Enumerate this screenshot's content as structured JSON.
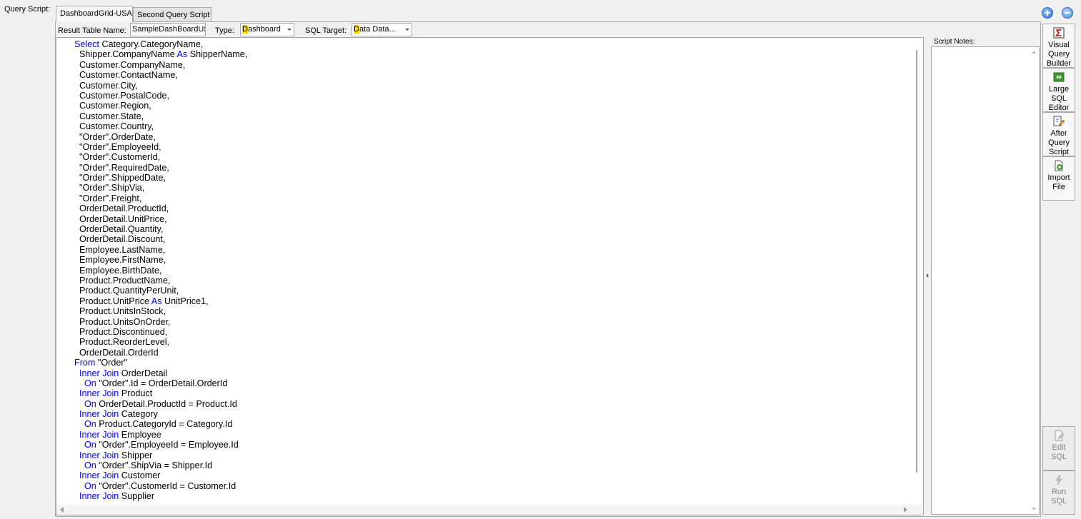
{
  "query_script_label": "Query Script:",
  "tabs": [
    {
      "label": "DashboardGrid-USA",
      "active": true
    },
    {
      "label": "Second Query Script",
      "active": false
    }
  ],
  "fields": {
    "result_table_label": "Result Table Name:",
    "result_table_value": "SampleDashBoardUS",
    "type_label": "Type:",
    "type_value_first": "D",
    "type_value_rest": "ashboard",
    "sql_target_label": "SQL Target:",
    "sql_target_value_first": "D",
    "sql_target_value_rest": "ata Data..."
  },
  "notes": {
    "label": "Script Notes:",
    "value": ""
  },
  "toolbar": {
    "visual_query_builder": "Visual\nQuery\nBuilder",
    "large_sql_editor": "Large\nSQL\nEditor",
    "after_query_script": "After\nQuery\nScript",
    "import_file": "Import\nFile",
    "edit_sql": "Edit\nSQL",
    "run_sql": "Run\nSQL"
  },
  "colors": {
    "keyword": "#0000ff",
    "highlight": "#ffd800"
  },
  "icons": [
    "add-circle-icon",
    "remove-circle-icon",
    "sigma-icon",
    "editor-icon",
    "script-pencil-icon",
    "import-file-icon",
    "edit-sql-icon",
    "lightning-icon"
  ],
  "code_lines": [
    {
      "indent": "",
      "kw": "Select",
      "text": " Category.CategoryName,"
    },
    {
      "indent": "  ",
      "kw": "",
      "text": "Shipper.CompanyName ",
      "kw2": "As",
      "text2": " ShipperName,"
    },
    {
      "indent": "  ",
      "kw": "",
      "text": "Customer.CompanyName,"
    },
    {
      "indent": "  ",
      "kw": "",
      "text": "Customer.ContactName,"
    },
    {
      "indent": "  ",
      "kw": "",
      "text": "Customer.City,"
    },
    {
      "indent": "  ",
      "kw": "",
      "text": "Customer.PostalCode,"
    },
    {
      "indent": "  ",
      "kw": "",
      "text": "Customer.Region,"
    },
    {
      "indent": "  ",
      "kw": "",
      "text": "Customer.State,"
    },
    {
      "indent": "  ",
      "kw": "",
      "text": "Customer.Country,"
    },
    {
      "indent": "  ",
      "kw": "",
      "text": "\"Order\".OrderDate,"
    },
    {
      "indent": "  ",
      "kw": "",
      "text": "\"Order\".EmployeeId,"
    },
    {
      "indent": "  ",
      "kw": "",
      "text": "\"Order\".CustomerId,"
    },
    {
      "indent": "  ",
      "kw": "",
      "text": "\"Order\".RequiredDate,"
    },
    {
      "indent": "  ",
      "kw": "",
      "text": "\"Order\".ShippedDate,"
    },
    {
      "indent": "  ",
      "kw": "",
      "text": "\"Order\".ShipVia,"
    },
    {
      "indent": "  ",
      "kw": "",
      "text": "\"Order\".Freight,"
    },
    {
      "indent": "  ",
      "kw": "",
      "text": "OrderDetail.ProductId,"
    },
    {
      "indent": "  ",
      "kw": "",
      "text": "OrderDetail.UnitPrice,"
    },
    {
      "indent": "  ",
      "kw": "",
      "text": "OrderDetail.Quantity,"
    },
    {
      "indent": "  ",
      "kw": "",
      "text": "OrderDetail.Discount,"
    },
    {
      "indent": "  ",
      "kw": "",
      "text": "Employee.LastName,"
    },
    {
      "indent": "  ",
      "kw": "",
      "text": "Employee.FirstName,"
    },
    {
      "indent": "  ",
      "kw": "",
      "text": "Employee.BirthDate,"
    },
    {
      "indent": "  ",
      "kw": "",
      "text": "Product.ProductName,"
    },
    {
      "indent": "  ",
      "kw": "",
      "text": "Product.QuantityPerUnit,"
    },
    {
      "indent": "  ",
      "kw": "",
      "text": "Product.UnitPrice ",
      "kw2": "As",
      "text2": " UnitPrice1,"
    },
    {
      "indent": "  ",
      "kw": "",
      "text": "Product.UnitsInStock,"
    },
    {
      "indent": "  ",
      "kw": "",
      "text": "Product.UnitsOnOrder,"
    },
    {
      "indent": "  ",
      "kw": "",
      "text": "Product.Discontinued,"
    },
    {
      "indent": "  ",
      "kw": "",
      "text": "Product.ReorderLevel,"
    },
    {
      "indent": "  ",
      "kw": "",
      "text": "OrderDetail.OrderId"
    },
    {
      "indent": "",
      "kw": "From",
      "text": " \"Order\""
    },
    {
      "indent": "  ",
      "kw": "Inner Join",
      "text": " OrderDetail"
    },
    {
      "indent": "    ",
      "kw": "On",
      "text": " \"Order\".Id = OrderDetail.OrderId"
    },
    {
      "indent": "  ",
      "kw": "Inner Join",
      "text": " Product"
    },
    {
      "indent": "    ",
      "kw": "On",
      "text": " OrderDetail.ProductId = Product.Id"
    },
    {
      "indent": "  ",
      "kw": "Inner Join",
      "text": " Category"
    },
    {
      "indent": "    ",
      "kw": "On",
      "text": " Product.CategoryId = Category.Id"
    },
    {
      "indent": "  ",
      "kw": "Inner Join",
      "text": " Employee"
    },
    {
      "indent": "    ",
      "kw": "On",
      "text": " \"Order\".EmployeeId = Employee.Id"
    },
    {
      "indent": "  ",
      "kw": "Inner Join",
      "text": " Shipper"
    },
    {
      "indent": "    ",
      "kw": "On",
      "text": " \"Order\".ShipVia = Shipper.Id"
    },
    {
      "indent": "  ",
      "kw": "Inner Join",
      "text": " Customer"
    },
    {
      "indent": "    ",
      "kw": "On",
      "text": " \"Order\".CustomerId = Customer.Id"
    },
    {
      "indent": "  ",
      "kw": "Inner Join",
      "text": " Supplier"
    }
  ]
}
